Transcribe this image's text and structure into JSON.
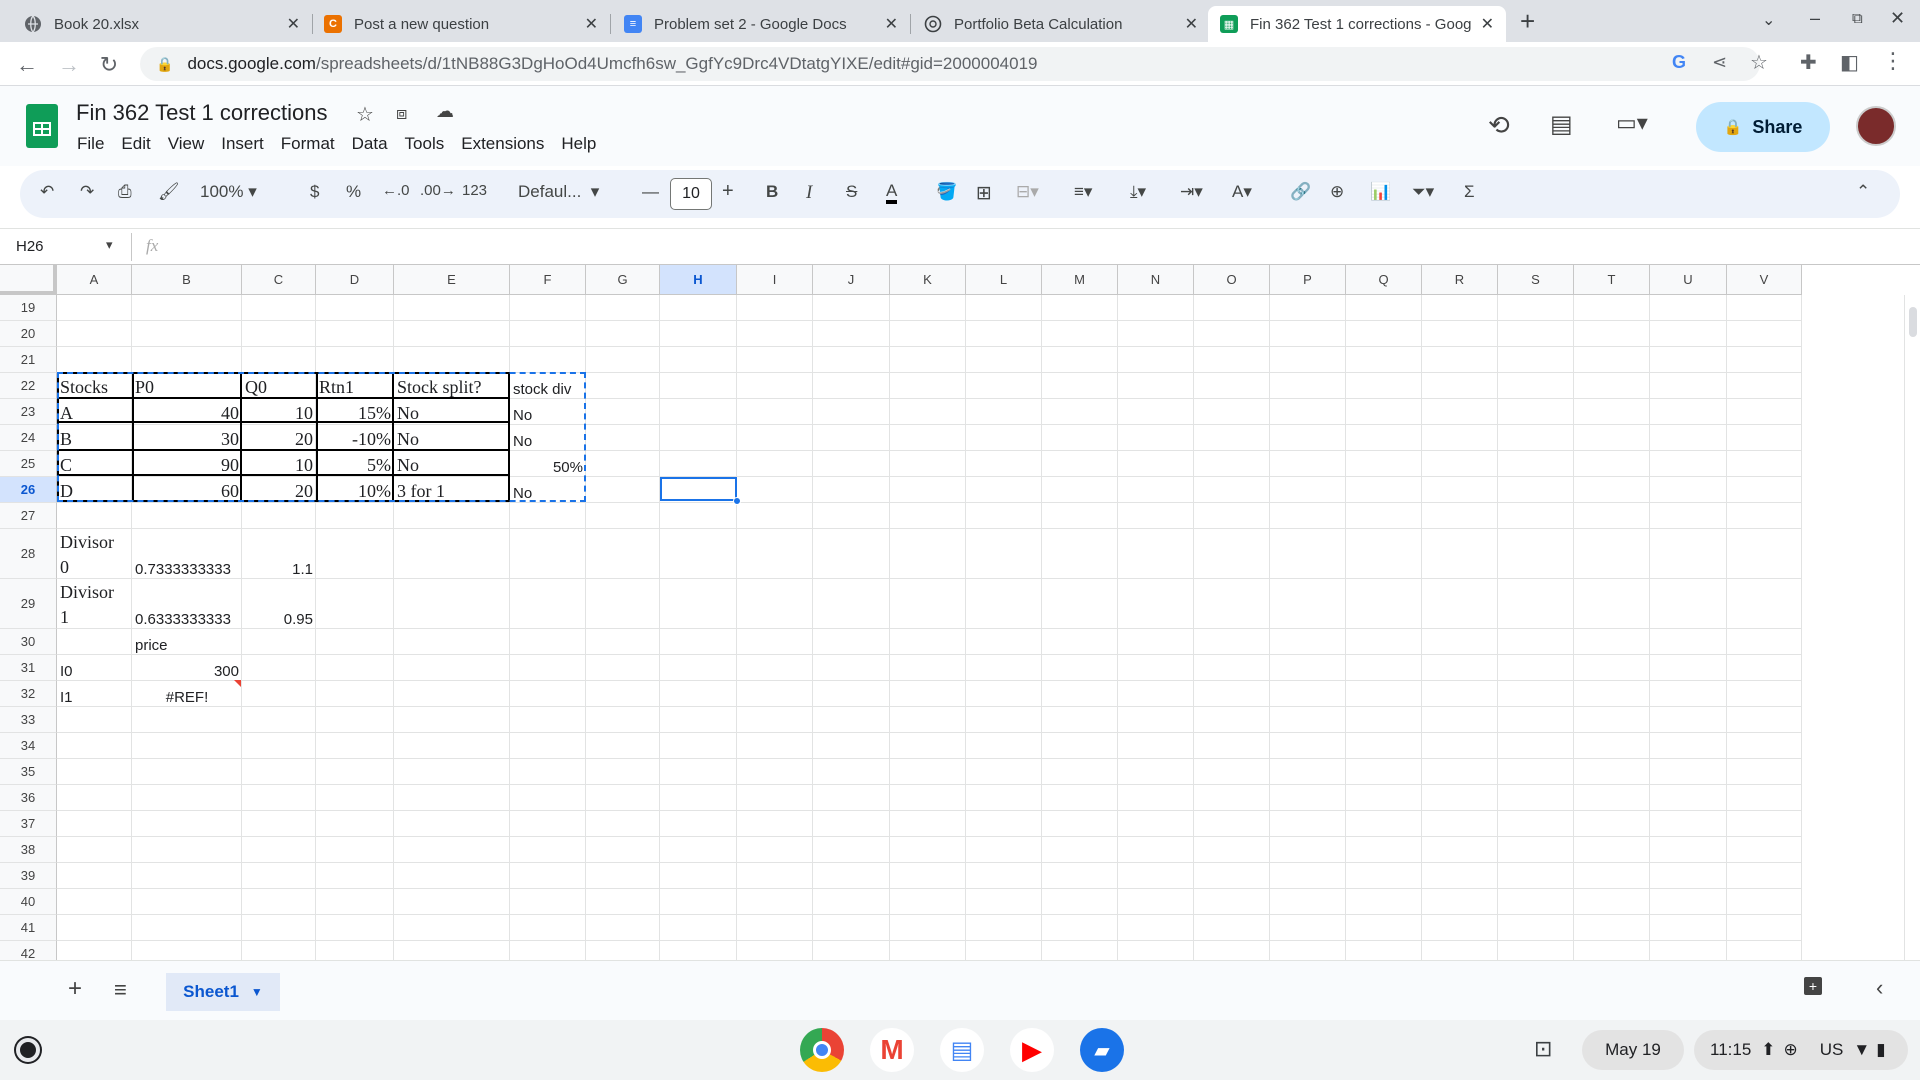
{
  "browser": {
    "tabs": [
      {
        "title": "Book 20.xlsx",
        "icon": "globe-icon",
        "active": false
      },
      {
        "title": "Post a new question",
        "icon": "chegg-icon",
        "active": false
      },
      {
        "title": "Problem set 2 - Google Docs",
        "icon": "docs-icon",
        "active": false
      },
      {
        "title": "Portfolio Beta Calculation",
        "icon": "openai-icon",
        "active": false
      },
      {
        "title": "Fin 362 Test 1 corrections - Goog",
        "icon": "sheets-icon",
        "active": true
      }
    ],
    "new_tab": "+",
    "url_host": "docs.google.com",
    "url_path": "/spreadsheets/d/1tNB88G3DgHoOd4Umcfh6sw_GgfYc9Drc4VDtatgYIXE/edit#gid=2000004019"
  },
  "doc": {
    "title": "Fin 362 Test 1 corrections",
    "menu": [
      "File",
      "Edit",
      "View",
      "Insert",
      "Format",
      "Data",
      "Tools",
      "Extensions",
      "Help"
    ],
    "share_label": "Share"
  },
  "toolbar": {
    "zoom": "100%",
    "currency": "$",
    "percent": "%",
    "dec_decrease": ".0",
    "dec_increase": ".00",
    "number_format": "123",
    "font": "Defaul...",
    "font_size": "10",
    "bold": "B",
    "italic": "I",
    "text_color": "A"
  },
  "formula_bar": {
    "name_box": "H26",
    "fx": "fx",
    "content": ""
  },
  "columns": [
    "A",
    "B",
    "C",
    "D",
    "E",
    "F",
    "G",
    "H",
    "I",
    "J",
    "K",
    "L",
    "M",
    "N",
    "O",
    "P",
    "Q",
    "R",
    "S",
    "T",
    "U",
    "V"
  ],
  "rows": [
    "19",
    "20",
    "21",
    "22",
    "23",
    "24",
    "25",
    "26",
    "27",
    "28",
    "29",
    "30",
    "31",
    "32",
    "33",
    "34",
    "35",
    "36",
    "37",
    "38",
    "39",
    "40",
    "41",
    "42"
  ],
  "cells": {
    "A22": "Stocks",
    "B22": "P0",
    "C22": "Q0",
    "D22": "Rtn1",
    "E22": "Stock split?",
    "F22": "stock div",
    "A23": "A",
    "B23": "40",
    "C23": "10",
    "D23": "15%",
    "E23": "No",
    "F23": "No",
    "A24": "B",
    "B24": "30",
    "C24": "20",
    "D24": "-10%",
    "E24": "No",
    "F24": "No",
    "A25": "C",
    "B25": "90",
    "C25": "10",
    "D25": "5%",
    "E25": "No",
    "F25": "50%",
    "A26": "D",
    "B26": "60",
    "C26": "20",
    "D26": "10%",
    "E26": "3 for 1",
    "F26": "No",
    "A28_1": "Divisor",
    "A28_2": "0",
    "B28": "0.7333333333",
    "C28": "1.1",
    "A29_1": "Divisor",
    "A29_2": "1",
    "B29": "0.6333333333",
    "C29": "0.95",
    "B30": "price",
    "A31": "I0",
    "B31": "300",
    "A32": "I1",
    "B32": "#REF!"
  },
  "sheets": [
    {
      "name": "Sheet1",
      "active": true
    }
  ],
  "shelf": {
    "date": "May 19",
    "time": "11:15",
    "locale": "US"
  },
  "colors": {
    "accent": "#1a73e8",
    "share_bg": "#c2e7ff",
    "selection": "#1a73e8",
    "sheets_green": "#0f9d58"
  }
}
